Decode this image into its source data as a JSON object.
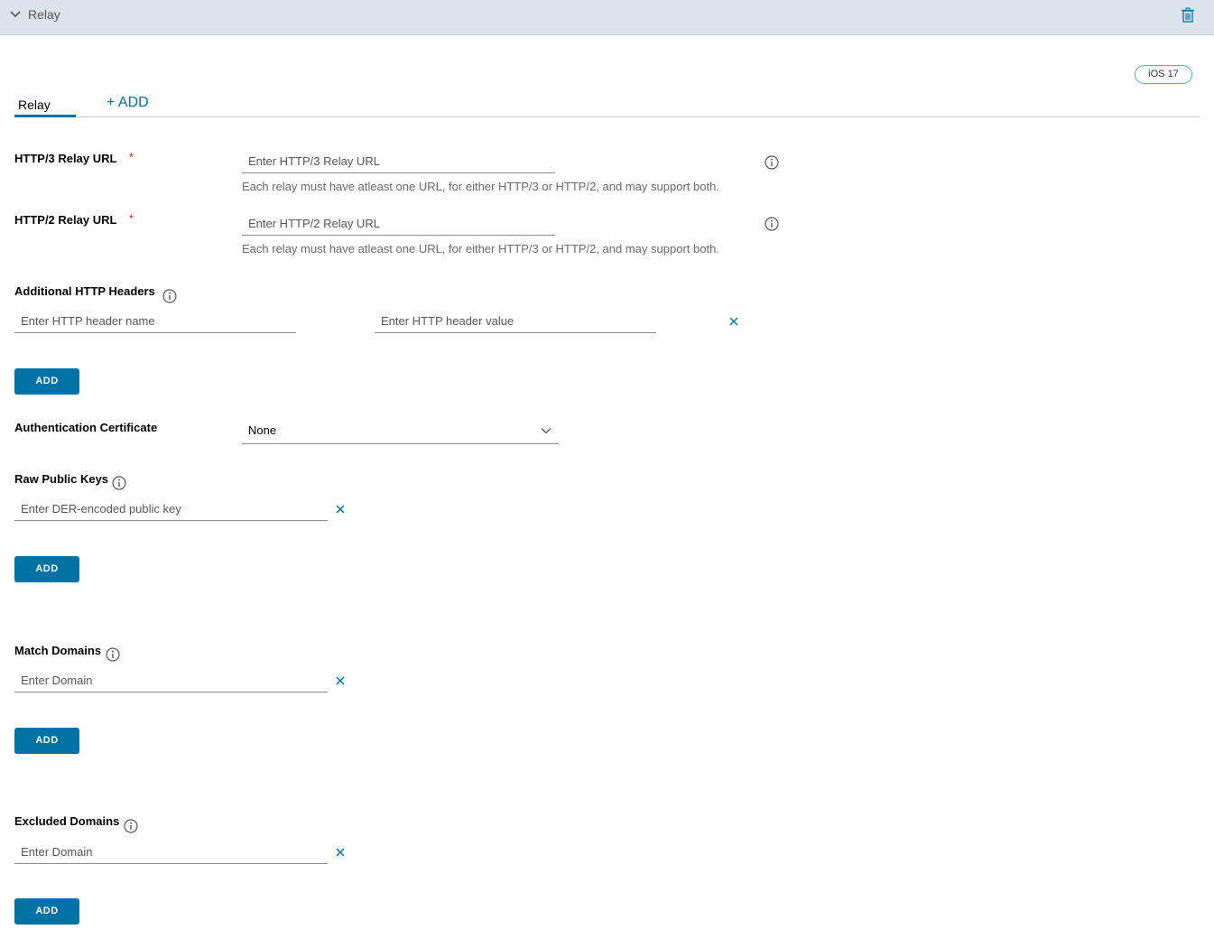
{
  "header": {
    "title": "Relay",
    "chevron_icon": "chevron-down-icon",
    "delete_icon": "trash-icon"
  },
  "badge": {
    "label": "iOS 17"
  },
  "tabs": {
    "active_label": "Relay",
    "add_label": "+ ADD"
  },
  "colors": {
    "accent": "#0072a3",
    "header_bg": "#dbe4ec",
    "required": "#c21d00",
    "badge_border": "#49afd9"
  },
  "fields": {
    "http3": {
      "label": "HTTP/3 Relay URL",
      "required_mark": "*",
      "placeholder": "Enter HTTP/3 Relay URL",
      "helper": "Each relay must have atleast one URL, for either HTTP/3 or HTTP/2, and may support both."
    },
    "http2": {
      "label": "HTTP/2 Relay URL",
      "required_mark": "*",
      "placeholder": "Enter HTTP/2 Relay URL",
      "helper": "Each relay must have atleast one URL, for either HTTP/3 or HTTP/2, and may support both."
    },
    "headers": {
      "label": "Additional HTTP Headers",
      "name_placeholder": "Enter HTTP header name",
      "value_placeholder": "Enter HTTP header value",
      "add_label": "ADD"
    },
    "auth_cert": {
      "label": "Authentication Certificate",
      "selected": "None"
    },
    "raw_keys": {
      "label": "Raw Public Keys",
      "placeholder": "Enter DER-encoded public key",
      "add_label": "ADD"
    },
    "match_domains": {
      "label": "Match Domains",
      "placeholder": "Enter Domain",
      "add_label": "ADD"
    },
    "excluded_domains": {
      "label": "Excluded Domains",
      "placeholder": "Enter Domain",
      "add_label": "ADD"
    }
  }
}
